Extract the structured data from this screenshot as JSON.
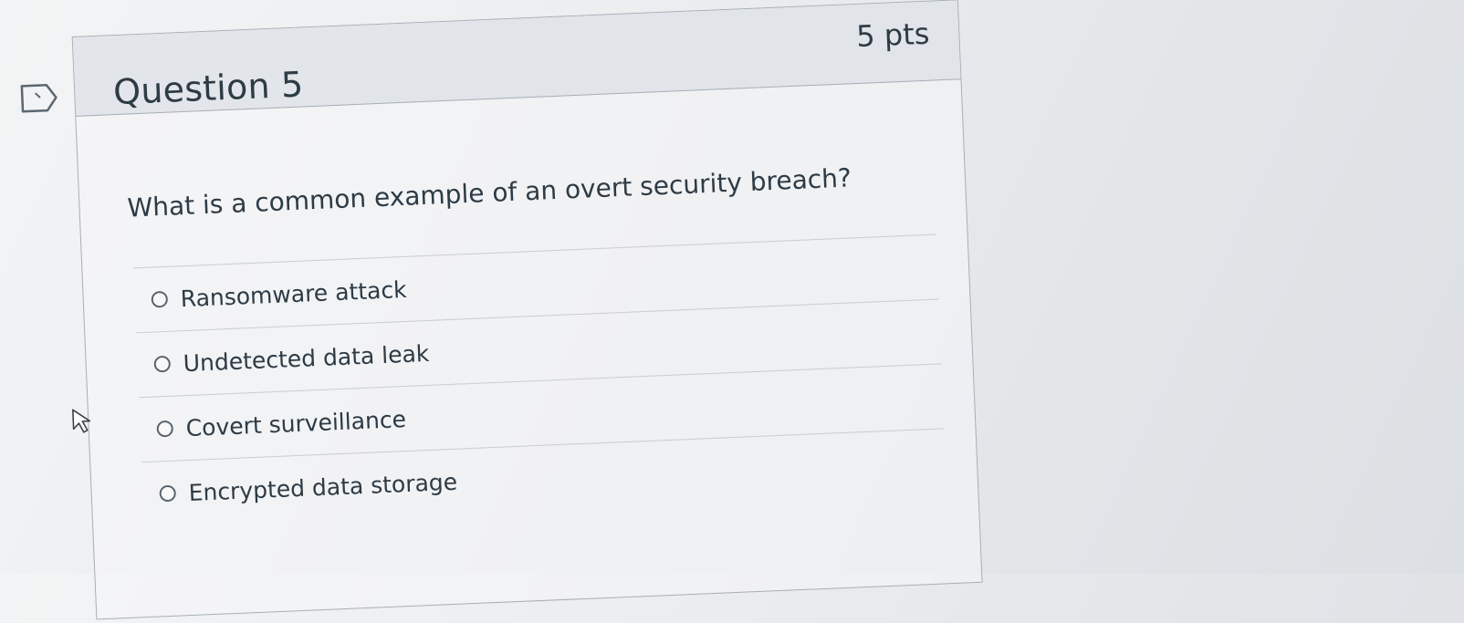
{
  "question": {
    "title": "Question 5",
    "points": "5 pts",
    "text": "What is a common example of an overt security breach?",
    "flag_icon": "flag-icon"
  },
  "answers": [
    {
      "label": "Ransomware attack",
      "selected": false
    },
    {
      "label": "Undetected data leak",
      "selected": false
    },
    {
      "label": "Covert surveillance",
      "selected": false
    },
    {
      "label": "Encrypted data storage",
      "selected": false
    }
  ],
  "colors": {
    "text": "#2d3b45",
    "border": "#a6afb6",
    "header_bg": "#dee2e6"
  }
}
